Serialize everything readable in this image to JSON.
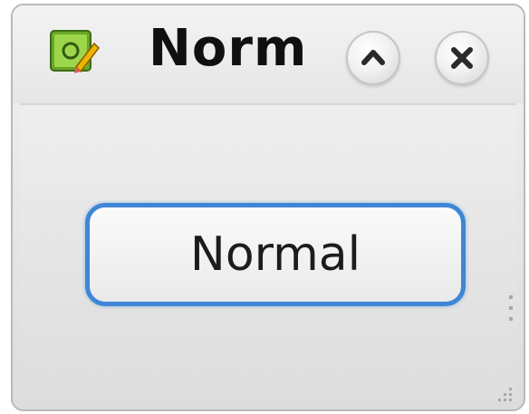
{
  "window": {
    "title": "Norm",
    "app_icon": "kwrite-icon",
    "shade_icon": "chevron-up-icon",
    "close_icon": "close-icon"
  },
  "content": {
    "button_label": "Normal"
  },
  "colors": {
    "focus_border": "#3f86d6",
    "icon_green": "#8ec83a",
    "text": "#101010"
  }
}
